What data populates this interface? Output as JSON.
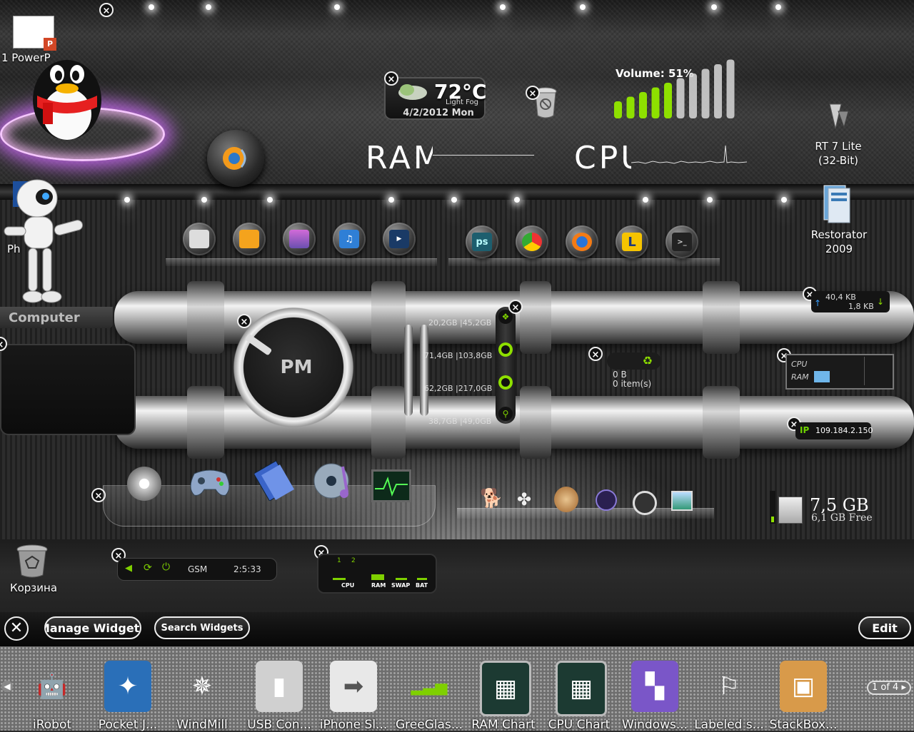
{
  "desktop_icons": {
    "ppt_file": "1 PowerP",
    "rt7": [
      "RT 7 Lite",
      "(32-Bit)"
    ],
    "restorator": [
      "Restorator",
      "2009"
    ],
    "computer": "Computer",
    "recycle": "Корзина",
    "partial_left": "Ph"
  },
  "weather": {
    "temp": "72°C",
    "condition": "Light Fog",
    "date": "4/2/2012 Mon"
  },
  "volume": {
    "label": "Volume: 51%",
    "level": 0.51
  },
  "monitor_labels": {
    "ram": "RAM",
    "cpu": "CPU"
  },
  "clock": {
    "ampm": "PM"
  },
  "drives": [
    {
      "used": "20,2GB",
      "total": "45,2GB"
    },
    {
      "used": "71,4GB",
      "total": "103,8GB"
    },
    {
      "used": "62,2GB",
      "total": "217,0GB"
    },
    {
      "used": "38,7GB",
      "total": "49,0GB"
    }
  ],
  "recycle_widget": {
    "size": "0 B",
    "items": "0 item(s)"
  },
  "network": {
    "up": "40,4 KB",
    "down": "1,8 KB"
  },
  "cpu_ram_meter": {
    "cpu_label": "CPU",
    "ram_label": "RAM"
  },
  "ip": {
    "prefix": "IP",
    "address": "109.184.2.150"
  },
  "disk_free": {
    "size": "7,5 GB",
    "free": "6,1 GB Free"
  },
  "gsm": {
    "label": "GSM",
    "time": "2:5:33"
  },
  "sysmeter": {
    "tabs": [
      "1",
      "2"
    ],
    "labels": [
      "CPU",
      "RAM",
      "SWAP",
      "BAT"
    ]
  },
  "dock": {
    "manage": "Manage Widgets",
    "search": "Search Widgets",
    "edit": "Edit",
    "pager": "1 of 4"
  },
  "gallery": [
    {
      "label": "iRobot",
      "icon": "robot-icon"
    },
    {
      "label": "Pocket J...",
      "icon": "bird-icon"
    },
    {
      "label": "WindMill",
      "icon": "pinwheel-icon"
    },
    {
      "label": "USB Con...",
      "icon": "usb-icon"
    },
    {
      "label": "iPhone Sl...",
      "icon": "arrow-icon"
    },
    {
      "label": "GreeGlas...",
      "icon": "signal-bars-icon"
    },
    {
      "label": "RAM Chart",
      "icon": "chart-screen-icon"
    },
    {
      "label": "CPU Chart",
      "icon": "chart-screen-icon"
    },
    {
      "label": "Windows...",
      "icon": "tiles-icon"
    },
    {
      "label": "Labeled s...",
      "icon": "ribbon-icon"
    },
    {
      "label": "StackBox...",
      "icon": "box-icon"
    }
  ],
  "colors": {
    "accent_green": "#8ee000",
    "purple_glow": "#d26bff",
    "ip_green": "#6fd400"
  }
}
